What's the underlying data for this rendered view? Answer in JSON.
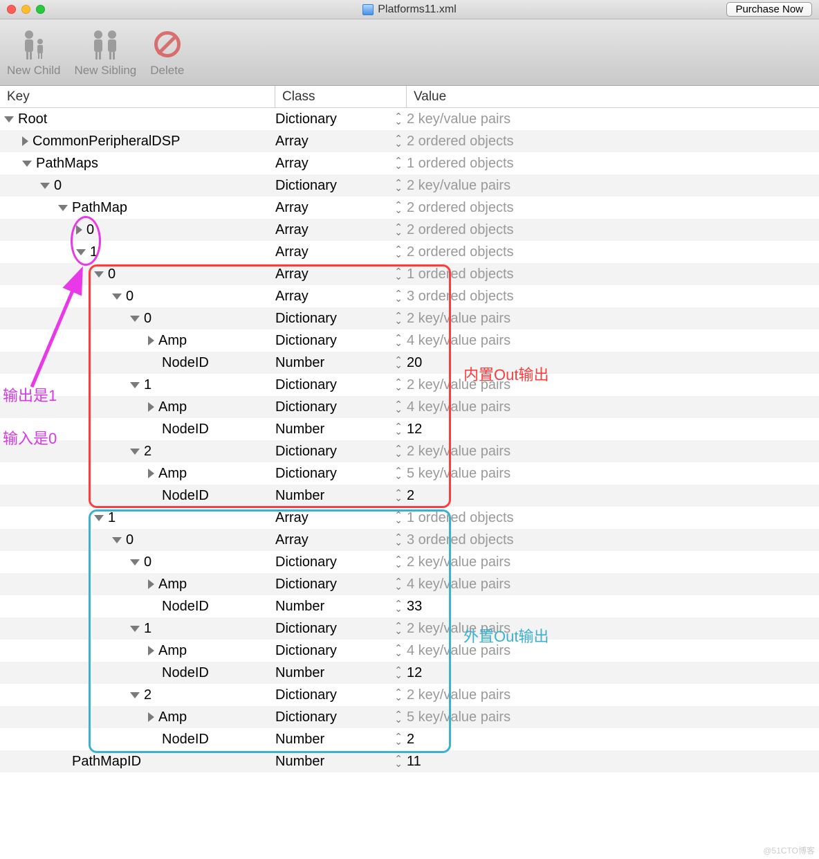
{
  "window": {
    "title": "Platforms11.xml",
    "purchase_btn": "Purchase Now"
  },
  "toolbar": {
    "new_child": "New Child",
    "new_sibling": "New Sibling",
    "delete": "Delete"
  },
  "headers": {
    "key": "Key",
    "class": "Class",
    "value": "Value"
  },
  "rows": [
    {
      "indent": 0,
      "disc": "down",
      "key": "Root",
      "class": "Dictionary",
      "value": "2 key/value pairs",
      "solid": false
    },
    {
      "indent": 1,
      "disc": "right",
      "key": "CommonPeripheralDSP",
      "class": "Array",
      "value": "2 ordered objects",
      "solid": false
    },
    {
      "indent": 1,
      "disc": "down",
      "key": "PathMaps",
      "class": "Array",
      "value": "1 ordered objects",
      "solid": false
    },
    {
      "indent": 2,
      "disc": "down",
      "key": "0",
      "class": "Dictionary",
      "value": "2 key/value pairs",
      "solid": false
    },
    {
      "indent": 3,
      "disc": "down",
      "key": "PathMap",
      "class": "Array",
      "value": "2 ordered objects",
      "solid": false
    },
    {
      "indent": 4,
      "disc": "right",
      "key": "0",
      "class": "Array",
      "value": "2 ordered objects",
      "solid": false
    },
    {
      "indent": 4,
      "disc": "down",
      "key": "1",
      "class": "Array",
      "value": "2 ordered objects",
      "solid": false
    },
    {
      "indent": 5,
      "disc": "down",
      "key": "0",
      "class": "Array",
      "value": "1 ordered objects",
      "solid": false
    },
    {
      "indent": 6,
      "disc": "down",
      "key": "0",
      "class": "Array",
      "value": "3 ordered objects",
      "solid": false
    },
    {
      "indent": 7,
      "disc": "down",
      "key": "0",
      "class": "Dictionary",
      "value": "2 key/value pairs",
      "solid": false
    },
    {
      "indent": 8,
      "disc": "right",
      "key": "Amp",
      "class": "Dictionary",
      "value": "4 key/value pairs",
      "solid": false
    },
    {
      "indent": 8,
      "disc": "none",
      "key": "NodeID",
      "class": "Number",
      "value": "20",
      "solid": true
    },
    {
      "indent": 7,
      "disc": "down",
      "key": "1",
      "class": "Dictionary",
      "value": "2 key/value pairs",
      "solid": false
    },
    {
      "indent": 8,
      "disc": "right",
      "key": "Amp",
      "class": "Dictionary",
      "value": "4 key/value pairs",
      "solid": false
    },
    {
      "indent": 8,
      "disc": "none",
      "key": "NodeID",
      "class": "Number",
      "value": "12",
      "solid": true
    },
    {
      "indent": 7,
      "disc": "down",
      "key": "2",
      "class": "Dictionary",
      "value": "2 key/value pairs",
      "solid": false
    },
    {
      "indent": 8,
      "disc": "right",
      "key": "Amp",
      "class": "Dictionary",
      "value": "5 key/value pairs",
      "solid": false
    },
    {
      "indent": 8,
      "disc": "none",
      "key": "NodeID",
      "class": "Number",
      "value": "2",
      "solid": true
    },
    {
      "indent": 5,
      "disc": "down",
      "key": "1",
      "class": "Array",
      "value": "1 ordered objects",
      "solid": false
    },
    {
      "indent": 6,
      "disc": "down",
      "key": "0",
      "class": "Array",
      "value": "3 ordered objects",
      "solid": false
    },
    {
      "indent": 7,
      "disc": "down",
      "key": "0",
      "class": "Dictionary",
      "value": "2 key/value pairs",
      "solid": false
    },
    {
      "indent": 8,
      "disc": "right",
      "key": "Amp",
      "class": "Dictionary",
      "value": "4 key/value pairs",
      "solid": false
    },
    {
      "indent": 8,
      "disc": "none",
      "key": "NodeID",
      "class": "Number",
      "value": "33",
      "solid": true
    },
    {
      "indent": 7,
      "disc": "down",
      "key": "1",
      "class": "Dictionary",
      "value": "2 key/value pairs",
      "solid": false
    },
    {
      "indent": 8,
      "disc": "right",
      "key": "Amp",
      "class": "Dictionary",
      "value": "4 key/value pairs",
      "solid": false
    },
    {
      "indent": 8,
      "disc": "none",
      "key": "NodeID",
      "class": "Number",
      "value": "12",
      "solid": true
    },
    {
      "indent": 7,
      "disc": "down",
      "key": "2",
      "class": "Dictionary",
      "value": "2 key/value pairs",
      "solid": false
    },
    {
      "indent": 8,
      "disc": "right",
      "key": "Amp",
      "class": "Dictionary",
      "value": "5 key/value pairs",
      "solid": false
    },
    {
      "indent": 8,
      "disc": "none",
      "key": "NodeID",
      "class": "Number",
      "value": "2",
      "solid": true
    },
    {
      "indent": 3,
      "disc": "none",
      "key": "PathMapID",
      "class": "Number",
      "value": "11",
      "solid": true
    }
  ],
  "annotations": {
    "output_is_1": "输出是1",
    "input_is_0": "输入是0",
    "builtin_out": "内置Out输出",
    "external_out": "外置Out输出"
  },
  "watermark": "@51CTO博客"
}
